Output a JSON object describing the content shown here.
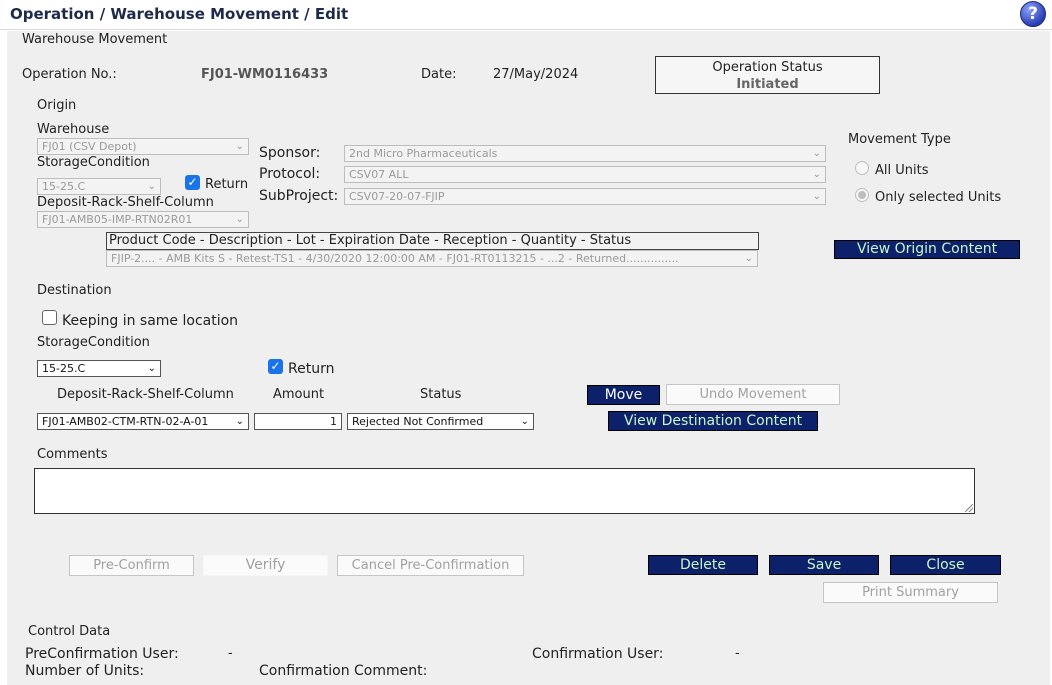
{
  "header": {
    "title": "Operation / Warehouse Movement / Edit",
    "help_glyph": "?"
  },
  "form": {
    "section_title": "Warehouse Movement",
    "operation_no_label": "Operation No.:",
    "operation_no_value": "FJ01-WM0116433",
    "date_label": "Date:",
    "date_value": "27/May/2024",
    "status_label": "Operation Status",
    "status_value": "Initiated"
  },
  "origin": {
    "title": "Origin",
    "warehouse_label": "Warehouse",
    "warehouse_value": "FJ01 (CSV Depot)",
    "storage_label": "StorageCondition",
    "storage_value": "15-25.C",
    "return_label": "Return",
    "return_checked": true,
    "drsc_label": "Deposit-Rack-Shelf-Column",
    "drsc_value": "FJ01-AMB05-IMP-RTN02R01",
    "sponsor_label": "Sponsor:",
    "sponsor_value": "2nd Micro Pharmaceuticals",
    "protocol_label": "Protocol:",
    "protocol_value": "CSV07 ALL",
    "subproject_label": "SubProject:",
    "subproject_value": "CSV07-20-07-FJIP",
    "product_header": "Product Code - Description - Lot - Expiration Date - Reception - Quantity - Status",
    "product_value": "FJIP-2.... - AMB Kits S - Retest-TS1 - 4/30/2020 12:00:00 AM - FJ01-RT0113215 - ...2 - Returned...............",
    "view_origin_label": "View Origin Content"
  },
  "movement_type": {
    "title": "Movement Type",
    "all_units_label": "All Units",
    "selected_units_label": "Only selected Units",
    "selected": "Only selected Units"
  },
  "destination": {
    "title": "Destination",
    "keep_label": "Keeping in same location",
    "keep_checked": false,
    "storage_label": "StorageCondition",
    "storage_value": "15-25.C",
    "return_label": "Return",
    "return_checked": true,
    "drsc_label": "Deposit-Rack-Shelf-Column",
    "drsc_value": "FJ01-AMB02-CTM-RTN-02-A-01",
    "amount_label": "Amount",
    "amount_value": "1",
    "status_label": "Status",
    "status_value": "Rejected Not Confirmed",
    "move_label": "Move",
    "undo_label": "Undo Movement",
    "view_dest_label": "View Destination Content"
  },
  "comments": {
    "label": "Comments",
    "value": ""
  },
  "actions": {
    "preconfirm": "Pre-Confirm",
    "verify": "Verify",
    "cancel_preconfirm": "Cancel Pre-Confirmation",
    "delete": "Delete",
    "save": "Save",
    "close": "Close",
    "print_summary": "Print Summary"
  },
  "control": {
    "title": "Control Data",
    "preconf_user_label": "PreConfirmation User:",
    "preconf_user_value": "-",
    "conf_user_label": "Confirmation User:",
    "conf_user_value": "-",
    "num_units_label": "Number of Units:",
    "conf_comment_label": "Confirmation Comment:"
  },
  "colors": {
    "navy": "#0c2169",
    "button_text": "#c8f7c8",
    "check_blue": "#1a73e8"
  }
}
